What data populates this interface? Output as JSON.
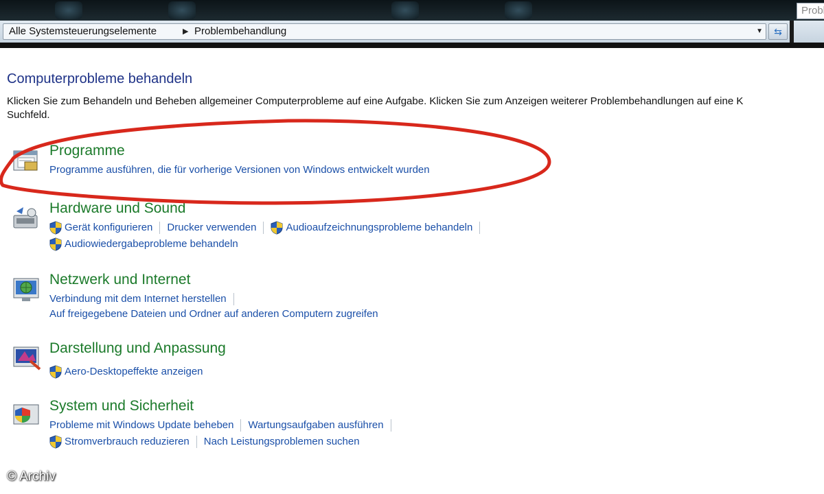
{
  "addressbar": {
    "breadcrumb_1": "Alle Systemsteuerungselemente",
    "breadcrumb_2": "Problembehandlung",
    "search_placeholder": "Probl"
  },
  "main": {
    "title": "Computerprobleme behandeln",
    "description_line1": "Klicken Sie zum Behandeln und Beheben allgemeiner Computerprobleme auf eine Aufgabe. Klicken Sie zum Anzeigen weiterer Problembehandlungen auf eine K",
    "description_line2": "Suchfeld."
  },
  "categories": [
    {
      "title": "Programme",
      "links": [
        "Programme ausführen, die für vorherige Versionen von Windows entwickelt wurden"
      ]
    },
    {
      "title": "Hardware und Sound",
      "links": [
        "Gerät konfigurieren",
        "Drucker verwenden",
        "Audioaufzeichnungsprobleme behandeln",
        "Audiowiedergabeprobleme behandeln"
      ]
    },
    {
      "title": "Netzwerk und Internet",
      "links": [
        "Verbindung mit dem Internet herstellen",
        "Auf freigegebene Dateien und Ordner auf anderen Computern zugreifen"
      ]
    },
    {
      "title": "Darstellung und Anpassung",
      "links": [
        "Aero-Desktopeffekte anzeigen"
      ]
    },
    {
      "title": "System und Sicherheit",
      "links": [
        "Probleme mit Windows Update beheben",
        "Wartungsaufgaben ausführen",
        "Stromverbrauch reduzieren",
        "Nach Leistungsproblemen suchen"
      ]
    }
  ],
  "watermark": "© Archiv",
  "colors": {
    "category_title": "#1b7a2a",
    "link": "#1a4fa8",
    "page_title": "#1e3287",
    "annotation_ellipse": "#d8281c"
  },
  "icons": {
    "shield": "uac-shield-icon",
    "programs": "programs-icon",
    "hardware": "hardware-sound-icon",
    "network": "network-internet-icon",
    "appearance": "appearance-icon",
    "system": "system-security-icon"
  }
}
